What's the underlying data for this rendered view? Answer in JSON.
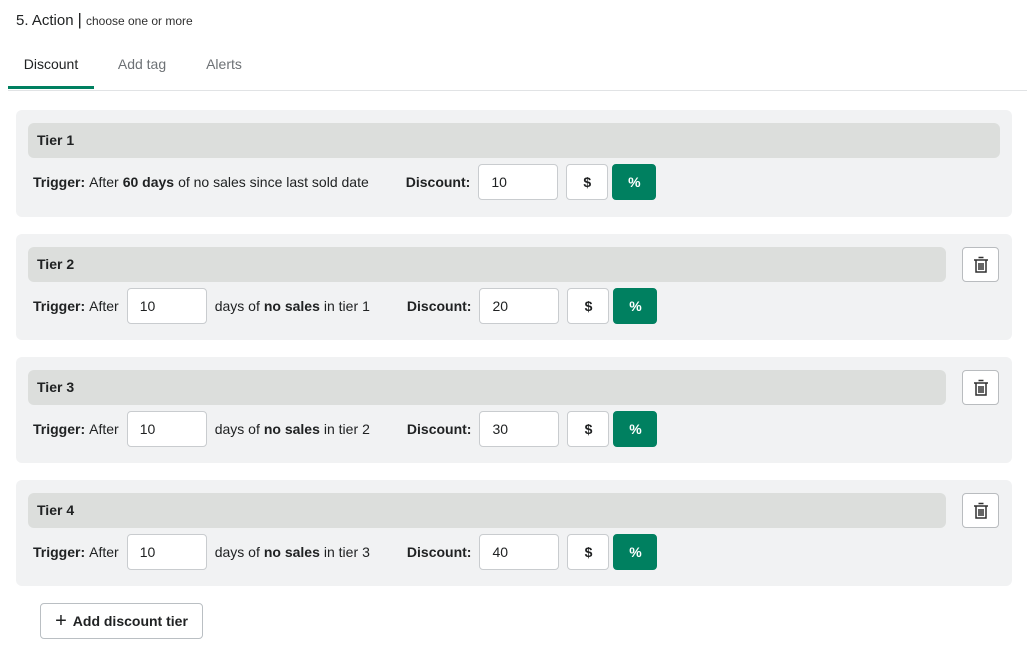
{
  "section": {
    "number_title": "5. Action",
    "separator": "|",
    "hint": "choose one or more"
  },
  "tabs": [
    {
      "label": "Discount",
      "active": true
    },
    {
      "label": "Add tag",
      "active": false
    },
    {
      "label": "Alerts",
      "active": false
    }
  ],
  "common": {
    "trigger_label": "Trigger:",
    "after": "After",
    "discount_label": "Discount:",
    "dollar": "$",
    "percent": "%",
    "days_of": "days of",
    "no_sales": "no sales",
    "in_tier": "in tier"
  },
  "tier1": {
    "title": "Tier 1",
    "trigger_pre": "After",
    "trigger_days": "60 days",
    "trigger_post": "of no sales since last sold date",
    "discount": "10",
    "unit": "%"
  },
  "tiers": [
    {
      "title": "Tier 2",
      "days": "10",
      "prev_tier": "1",
      "discount": "20",
      "unit": "%"
    },
    {
      "title": "Tier 3",
      "days": "10",
      "prev_tier": "2",
      "discount": "30",
      "unit": "%"
    },
    {
      "title": "Tier 4",
      "days": "10",
      "prev_tier": "3",
      "discount": "40",
      "unit": "%"
    }
  ],
  "add_tier": {
    "label": "Add discount tier",
    "icon": "plus-icon"
  },
  "icons": {
    "delete": "trash-icon"
  },
  "colors": {
    "accent": "#008060",
    "card_bg": "#f1f2f3",
    "header_bg": "#dcdedc"
  }
}
